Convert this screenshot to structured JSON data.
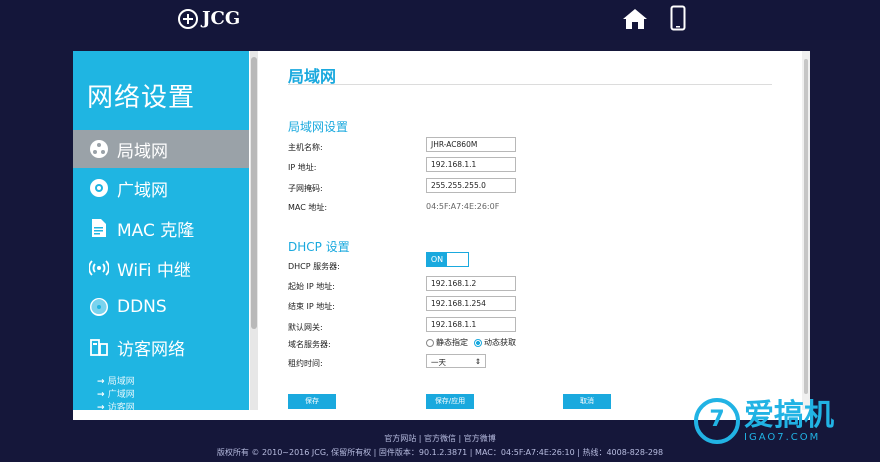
{
  "header": {
    "brand": "JCG",
    "icons": [
      "home-icon",
      "phone-icon"
    ]
  },
  "sidebar": {
    "title": "网络设置",
    "items": [
      {
        "label": "局域网",
        "icon": "lan-icon",
        "active": true
      },
      {
        "label": "广域网",
        "icon": "wan-icon",
        "active": false
      },
      {
        "label": "MAC 克隆",
        "icon": "document-icon",
        "active": false
      },
      {
        "label": "WiFi 中继",
        "icon": "wifi-icon",
        "active": false
      },
      {
        "label": "DDNS",
        "icon": "ddns-icon",
        "active": false
      },
      {
        "label": "访客网络",
        "icon": "guest-icon",
        "active": false
      }
    ],
    "sub_links": [
      "局域网",
      "广域网",
      "访客网"
    ]
  },
  "content": {
    "page_title": "局域网",
    "lan_section": {
      "title": "局域网设置",
      "hostname_label": "主机名称:",
      "hostname_value": "JHR-AC860M",
      "ip_label": "IP 地址:",
      "ip_value": "192.168.1.1",
      "mask_label": "子网掩码:",
      "mask_value": "255.255.255.0",
      "mac_label": "MAC 地址:",
      "mac_value": "04:5F:A7:4E:26:0F"
    },
    "dhcp_section": {
      "title": "DHCP 设置",
      "server_label": "DHCP 服务器:",
      "server_state": "ON",
      "start_label": "起始 IP 地址:",
      "start_value": "192.168.1.2",
      "end_label": "结束 IP 地址:",
      "end_value": "192.168.1.254",
      "gateway_label": "默认网关:",
      "gateway_value": "192.168.1.1",
      "dns_label": "域名服务器:",
      "dns_static": "静态指定",
      "dns_auto": "动态获取",
      "lease_label": "租约时间:",
      "lease_value": "一天"
    },
    "buttons": {
      "save": "保存",
      "save_apply": "保存/应用",
      "cancel": "取消"
    }
  },
  "footer": {
    "links": "官方网站 | 官方微信 | 官方微博",
    "info": "版权所有 © 2010~2016 JCG, 保留所有权  |  固件版本：90.1.2.3871  |  MAC：04:5F:A7:4E:26:10  |  热线：4008-828-298"
  },
  "watermark": {
    "brand": "爱搞机",
    "site": "IGAO7.COM",
    "mark": "7"
  },
  "colors": {
    "accent": "#1fb5e2",
    "background": "#15173a",
    "active_item": "#9aa2a8"
  }
}
